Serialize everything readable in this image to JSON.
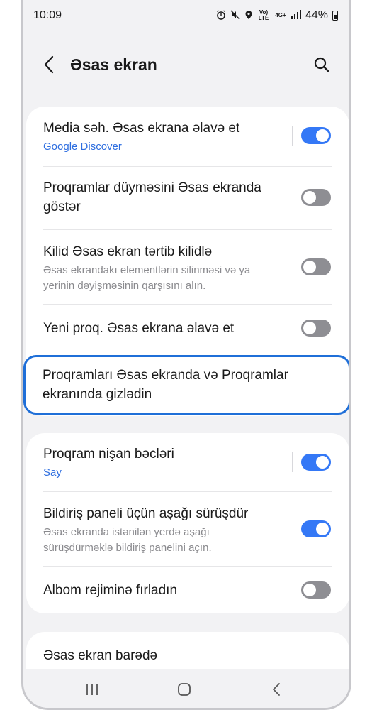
{
  "status": {
    "time": "10:09",
    "network_small": "Vo) LTE",
    "network_4g": "4G+",
    "battery": "44%"
  },
  "header": {
    "title": "Əsas ekran"
  },
  "card1": {
    "media_title": "Media səh. Əsas ekrana əlavə et",
    "media_sub": "Google Discover",
    "media_on": true,
    "apps_button_line1": "Proqramlar düyməsini Əsas ekranda",
    "apps_button_line2": "göstər",
    "apps_button_on": false,
    "lock_title": "Kilid Əsas ekran tərtib kilidlə",
    "lock_desc_line1": "Əsas ekrandakı elementlərin silinməsi və ya",
    "lock_desc_line2": "yerinin dəyişməsinin qarşısını alın.",
    "lock_on": false,
    "new_apps_title": "Yeni proq. Əsas ekrana əlavə et",
    "new_apps_on": false,
    "hide_apps_line1": "Proqramları Əsas ekranda və Proqramlar",
    "hide_apps_line2": "ekranında gizlədin"
  },
  "card2": {
    "badges_title": "Proqram nişan bəcləri",
    "badges_sub": "Say",
    "badges_on": true,
    "swipe_title": "Bildiriş paneli üçün aşağı sürüşdür",
    "swipe_desc_line1": "Əsas ekranda istənilən yerdə aşağı",
    "swipe_desc_line2": "sürüşdürməklə bildiriş panelini açın.",
    "swipe_on": true,
    "landscape_title": "Albom rejiminə fırladın",
    "landscape_on": false
  },
  "card3": {
    "about_title": "Əsas ekran barədə"
  },
  "colors": {
    "accent": "#3478f6",
    "highlight": "#1f6fd8",
    "link": "#2e6ee0",
    "toggle_off": "#8e8e93"
  }
}
